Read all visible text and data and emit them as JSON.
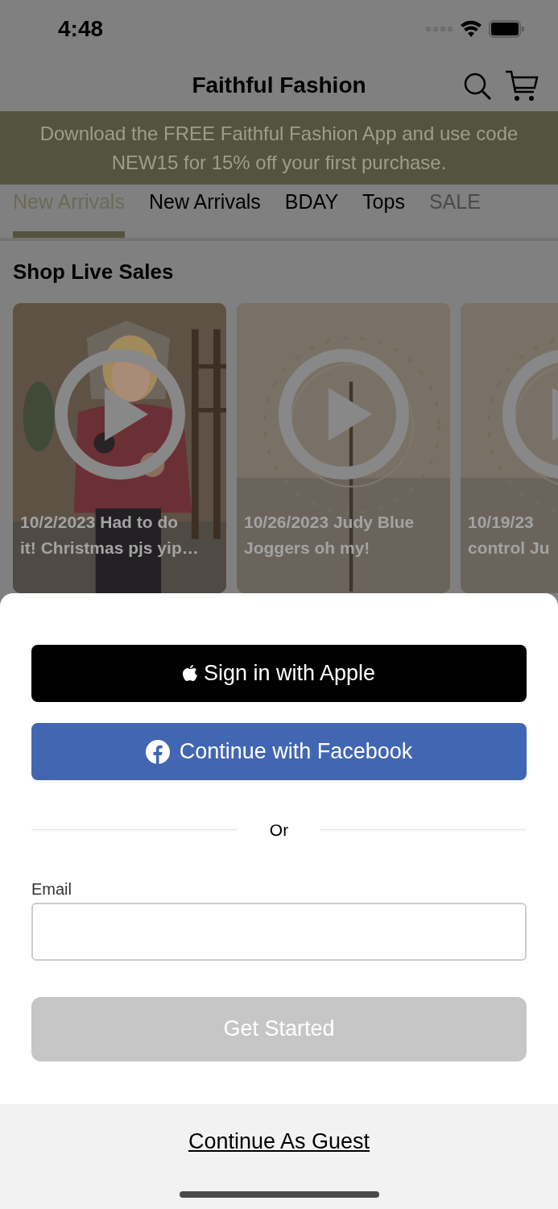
{
  "status_bar": {
    "time": "4:48"
  },
  "header": {
    "title": "Faithful Fashion"
  },
  "banner": {
    "text": "Download the FREE Faithful Fashion App and use code NEW15 for 15% off your first purchase."
  },
  "tabs": [
    {
      "label": "New Arrivals",
      "selected": true
    },
    {
      "label": "New Arrivals",
      "selected": false
    },
    {
      "label": "BDAY",
      "selected": false
    },
    {
      "label": "Tops",
      "selected": false
    },
    {
      "label": "SALE",
      "selected": false
    }
  ],
  "section": {
    "title": "Shop Live Sales"
  },
  "videos": [
    {
      "kind": "person",
      "lines": [
        "10/2/2023 Had to do",
        "it! Christmas pjs yip…"
      ]
    },
    {
      "kind": "logo",
      "lines": [
        "10/26/2023 Judy Blue",
        "Joggers oh my!"
      ]
    },
    {
      "kind": "logo",
      "lines": [
        "10/19/23",
        "control Ju"
      ]
    }
  ],
  "sheet": {
    "apple_button": "Sign in with Apple",
    "facebook_button": "Continue with Facebook",
    "divider": "Or",
    "email_label": "Email",
    "submit_button": {
      "label": "Get Started",
      "disabled": true
    },
    "guest_link": "Continue As Guest"
  }
}
